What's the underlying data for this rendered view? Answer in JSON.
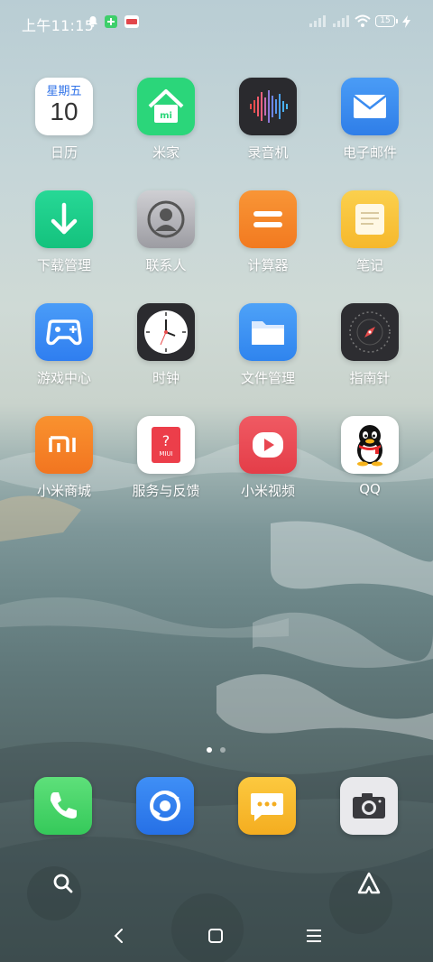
{
  "status_bar": {
    "time": "上午11:15",
    "battery_level": "15"
  },
  "calendar_widget": {
    "weekday": "星期五",
    "day": "10"
  },
  "apps": [
    {
      "label": "日历",
      "icon": "calendar-icon"
    },
    {
      "label": "米家",
      "icon": "mijia-home-icon"
    },
    {
      "label": "录音机",
      "icon": "voice-recorder-icon"
    },
    {
      "label": "电子邮件",
      "icon": "email-icon"
    },
    {
      "label": "下载管理",
      "icon": "download-arrow-icon"
    },
    {
      "label": "联系人",
      "icon": "contact-person-icon"
    },
    {
      "label": "计算器",
      "icon": "calculator-icon"
    },
    {
      "label": "笔记",
      "icon": "notes-icon"
    },
    {
      "label": "游戏中心",
      "icon": "gamepad-icon"
    },
    {
      "label": "时钟",
      "icon": "clock-icon"
    },
    {
      "label": "文件管理",
      "icon": "folder-icon"
    },
    {
      "label": "指南针",
      "icon": "compass-icon"
    },
    {
      "label": "小米商城",
      "icon": "mi-store-icon"
    },
    {
      "label": "服务与反馈",
      "icon": "question-book-icon"
    },
    {
      "label": "小米视频",
      "icon": "play-video-icon"
    },
    {
      "label": "QQ",
      "icon": "qq-penguin-icon"
    }
  ],
  "service_icon_text": "MIUI",
  "dock": [
    {
      "name": "phone",
      "icon": "phone-icon"
    },
    {
      "name": "browser",
      "icon": "browser-icon"
    },
    {
      "name": "messages",
      "icon": "message-bubble-icon"
    },
    {
      "name": "camera",
      "icon": "camera-icon"
    }
  ],
  "pages": {
    "count": 2,
    "current": 1
  },
  "colors": {
    "calendar_accent": "#2f72e8",
    "mijia_green": "#2bd67a",
    "email_blue": "#3b8cf0",
    "download_green": "#1fcf8c",
    "calculator_orange": "#f5852a",
    "notes_yellow": "#f8c33c",
    "game_blue": "#3d8cf5",
    "files_blue": "#3c8ff6",
    "mi_orange": "#f5822a",
    "video_red": "#ec4a55"
  }
}
